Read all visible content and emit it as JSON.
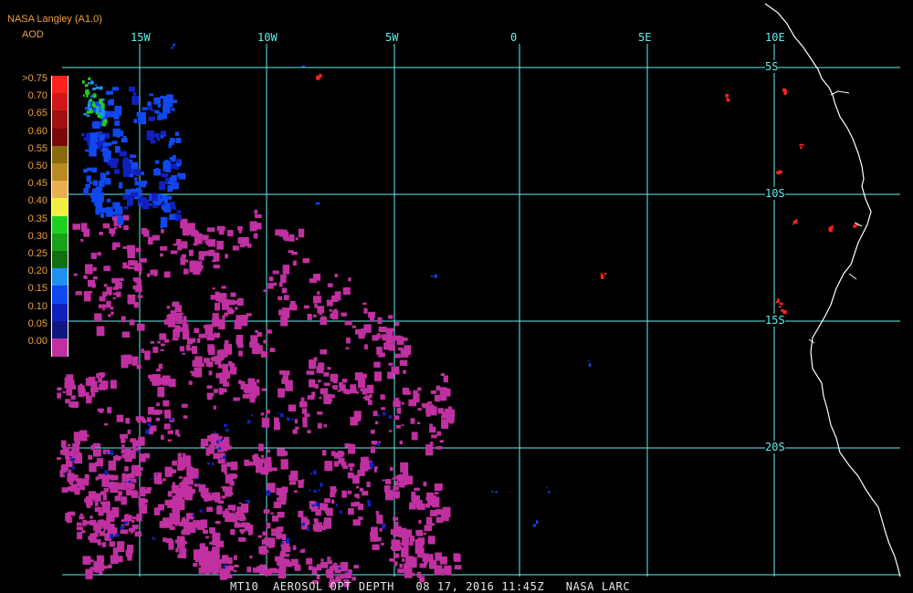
{
  "header": {
    "title": "NASA Langley (A1.0)",
    "subtitle": "AOD"
  },
  "colorbar": {
    "labels": [
      ">0.75",
      "0.70",
      "0.65",
      "0.60",
      "0.55",
      "0.50",
      "0.45",
      "0.40",
      "0.35",
      "0.30",
      "0.25",
      "0.20",
      "0.15",
      "0.10",
      "0.05",
      "0.00"
    ],
    "colors": [
      "#ff2020",
      "#d01818",
      "#a01010",
      "#7a0808",
      "#8a6a10",
      "#b88a20",
      "#e8b050",
      "#f0f040",
      "#20d020",
      "#18a018",
      "#107010",
      "#2090f0",
      "#1048f0",
      "#1020c0",
      "#101880",
      "#c030a0"
    ]
  },
  "grid": {
    "longitude_labels": [
      "15W",
      "10W",
      "5W",
      "0",
      "5E",
      "10E"
    ],
    "latitude_labels": [
      "5S",
      "10S",
      "15S",
      "20S"
    ],
    "line_color": "#5ff0f0"
  },
  "footer": {
    "text": "MT10  AEROSOL OPT DEPTH   08 17, 2016 11:45Z   NASA LARC"
  }
}
